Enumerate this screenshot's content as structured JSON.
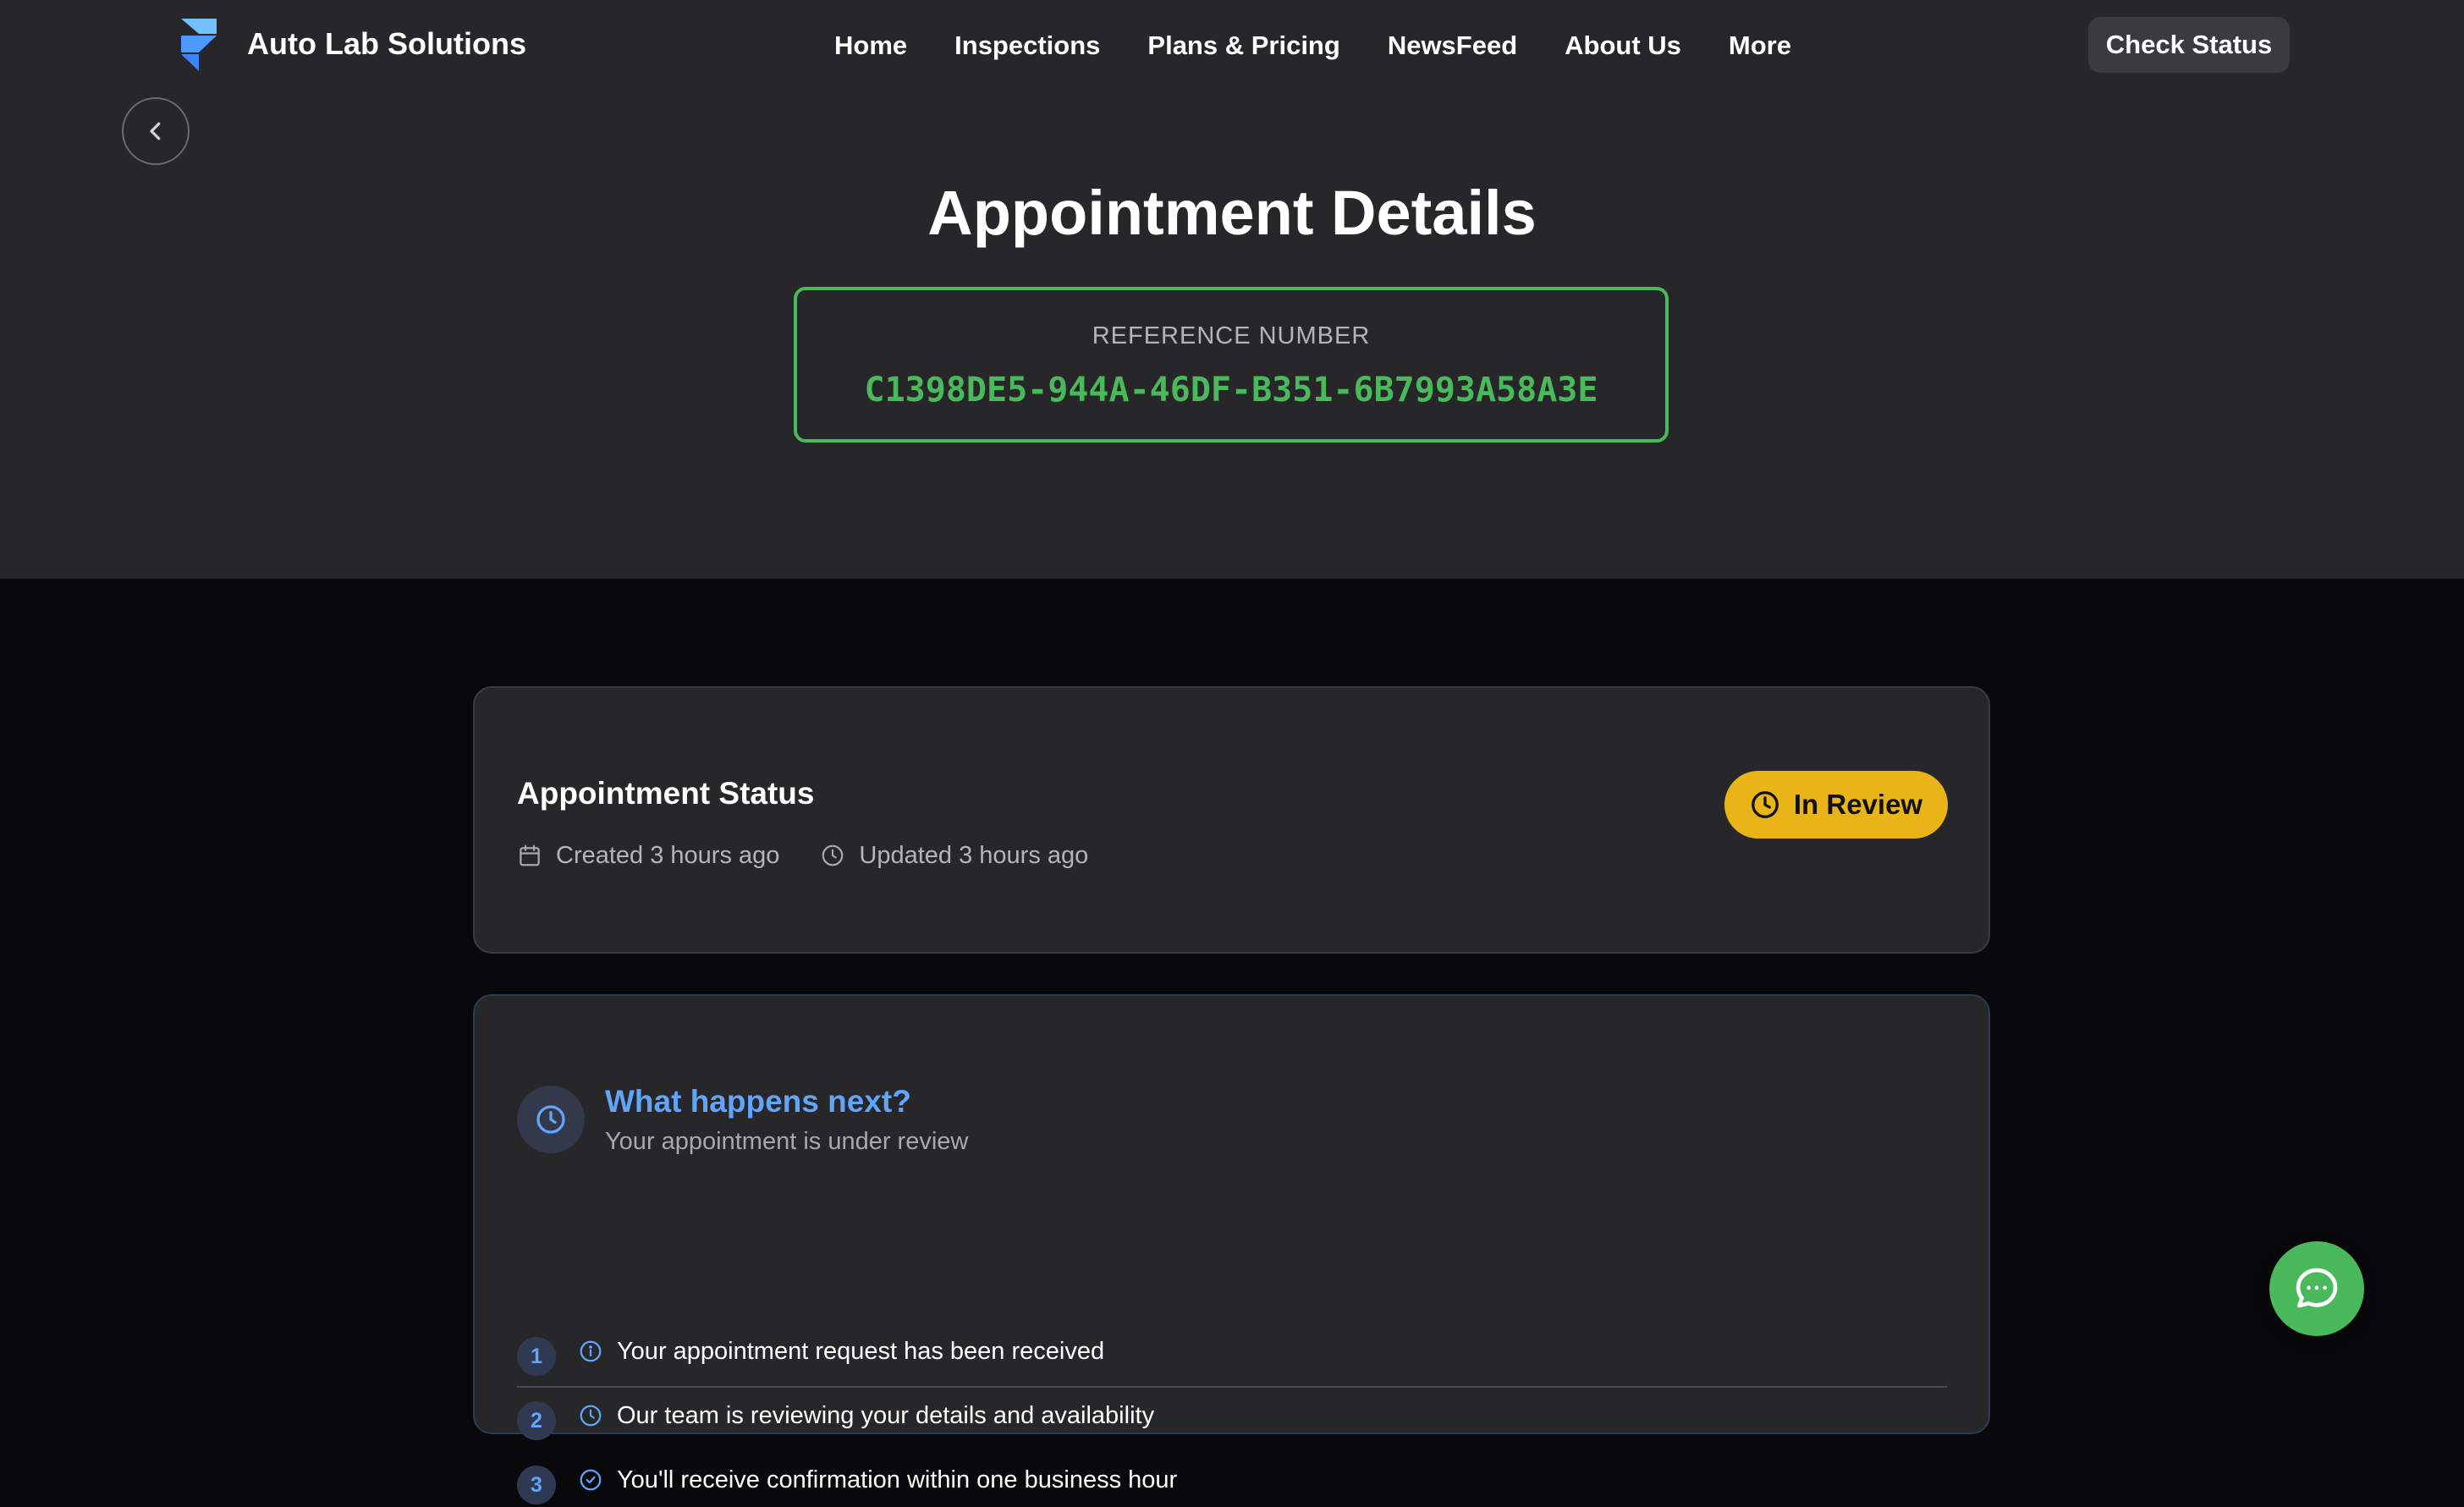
{
  "nav": {
    "brand": "Auto Lab Solutions",
    "links": [
      "Home",
      "Inspections",
      "Plans & Pricing",
      "NewsFeed",
      "About Us",
      "More"
    ],
    "cta": "Check Status"
  },
  "page": {
    "title": "Appointment Details",
    "reference_label": "REFERENCE NUMBER",
    "reference_value": "C1398DE5-944A-46DF-B351-6B7993A58A3E"
  },
  "status_card": {
    "title": "Appointment Status",
    "created": "Created 3 hours ago",
    "updated": "Updated 3 hours ago",
    "badge": "In Review"
  },
  "next_card": {
    "title": "What happens next?",
    "subtitle": "Your appointment is under review",
    "steps": [
      {
        "num": "1",
        "icon": "info-icon",
        "text": "Your appointment request has been received"
      },
      {
        "num": "2",
        "icon": "clock-icon",
        "text": "Our team is reviewing your details and availability"
      },
      {
        "num": "3",
        "icon": "check-circle-icon",
        "text": "You'll receive confirmation within one business hour"
      }
    ]
  },
  "colors": {
    "accent_green": "#4ab95b",
    "accent_blue": "#60a5fa",
    "badge_yellow": "#e8b418",
    "hero_bg": "#27272a",
    "page_bg": "#09090b"
  },
  "icons": {
    "logo": "framer-logo-icon",
    "back": "chevron-left-icon",
    "chat": "chat-bubble-icon"
  }
}
